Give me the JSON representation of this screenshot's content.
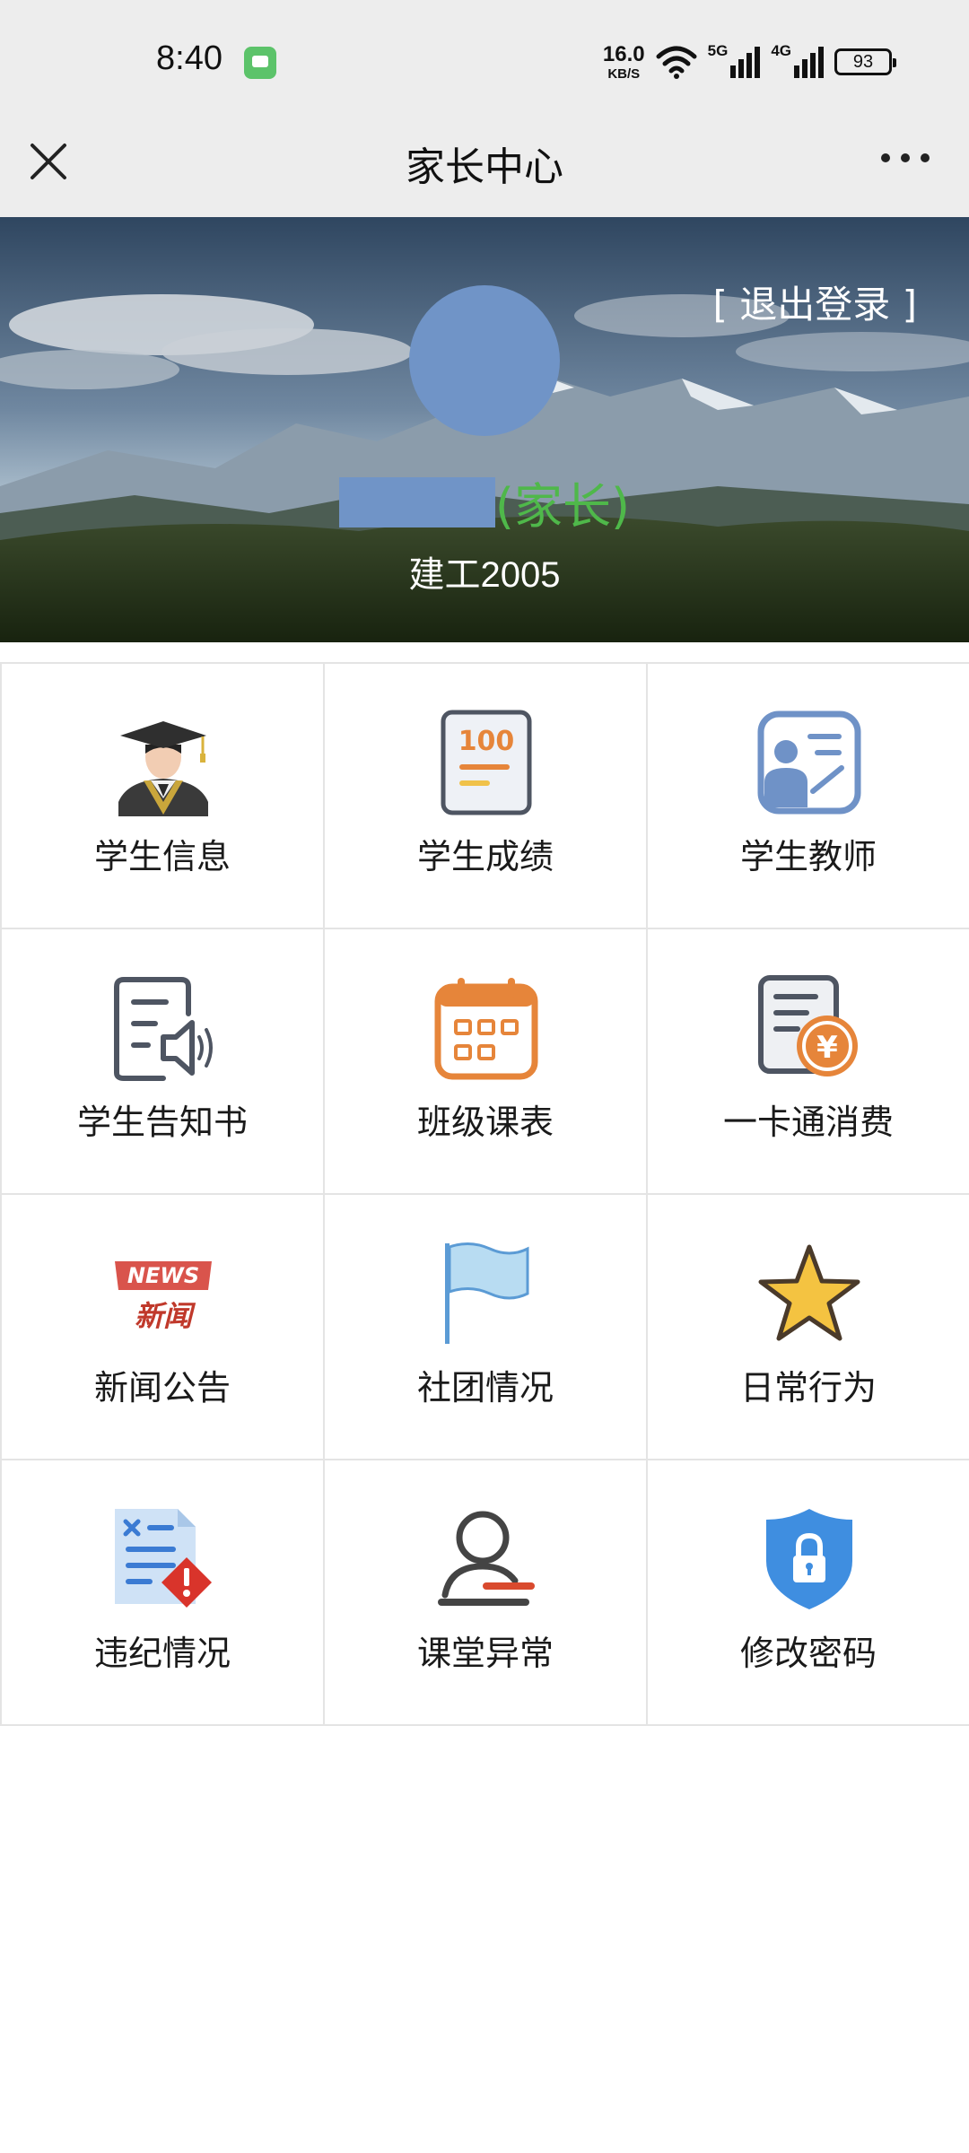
{
  "status_bar": {
    "time": "8:40",
    "net_speed_value": "16.0",
    "net_speed_unit": "KB/S",
    "net_5g": "5G",
    "net_4g": "4G",
    "battery": "93"
  },
  "title_bar": {
    "title": "家长中心",
    "close_icon": "close-icon",
    "more_icon": "more-icon"
  },
  "profile": {
    "logout": "[ 退出登录 ]",
    "role": "(家长)",
    "class_name": "建工2005",
    "avatar_color": "#7094c7",
    "role_color": "#4fb84a"
  },
  "menu": [
    {
      "label": "学生信息",
      "icon": "graduate-icon"
    },
    {
      "label": "学生成绩",
      "icon": "score-sheet-icon",
      "icon_text": "100"
    },
    {
      "label": "学生教师",
      "icon": "teacher-icon"
    },
    {
      "label": "学生告知书",
      "icon": "notice-speaker-icon"
    },
    {
      "label": "班级课表",
      "icon": "calendar-icon"
    },
    {
      "label": "一卡通消费",
      "icon": "card-payment-icon",
      "icon_text": "¥"
    },
    {
      "label": "新闻公告",
      "icon": "news-icon",
      "icon_text_top": "NEWS",
      "icon_text_bottom": "新闻"
    },
    {
      "label": "社团情况",
      "icon": "flag-icon"
    },
    {
      "label": "日常行为",
      "icon": "star-icon"
    },
    {
      "label": "违纪情况",
      "icon": "violation-doc-icon"
    },
    {
      "label": "课堂异常",
      "icon": "user-alert-icon"
    },
    {
      "label": "修改密码",
      "icon": "lock-shield-icon"
    }
  ]
}
